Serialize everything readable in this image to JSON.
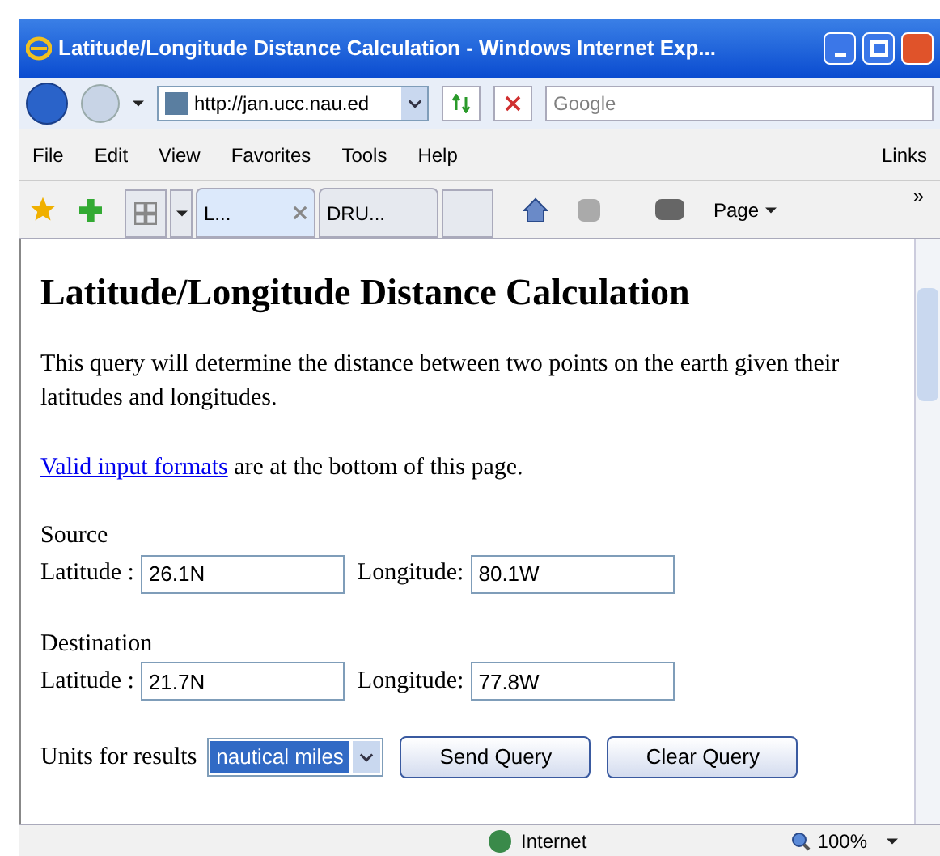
{
  "window": {
    "title": "Latitude/Longitude Distance Calculation - Windows Internet Exp..."
  },
  "address_bar": {
    "url": "http://jan.ucc.nau.ed"
  },
  "search": {
    "placeholder": "Google"
  },
  "menu": [
    "File",
    "Edit",
    "View",
    "Favorites",
    "Tools",
    "Help"
  ],
  "links": "Links",
  "tabs": [
    {
      "label": "L...",
      "selected": true
    },
    {
      "label": "DRU...",
      "selected": false
    }
  ],
  "toolbar": {
    "page": "Page",
    "more": "»"
  },
  "page": {
    "heading": "Latitude/Longitude Distance Calculation",
    "intro": "This query will determine the distance between two points on the earth given their latitudes and longitudes.",
    "link": "Valid input formats",
    "link_after": " are at the bottom of this page.",
    "sections": [
      {
        "title": "Source",
        "lat_label": "Latitude :",
        "lat": "26.1N",
        "lon_label": "Longitude:",
        "lon": "80.1W"
      },
      {
        "title": "Destination",
        "lat_label": "Latitude :",
        "lat": "21.7N",
        "lon_label": "Longitude:",
        "lon": "77.8W"
      }
    ],
    "units_label": "Units for results",
    "units": "nautical miles",
    "buttons": [
      "Send Query",
      "Clear Query"
    ]
  },
  "status_bar": {
    "zone": "Internet",
    "zoom": "100%"
  }
}
